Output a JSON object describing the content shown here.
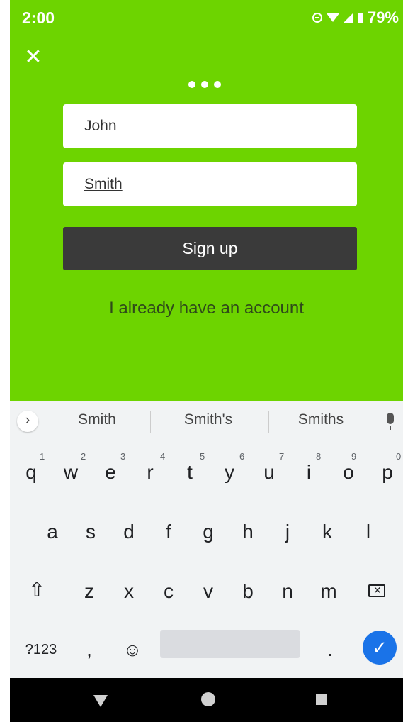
{
  "status_bar": {
    "time": "2:00",
    "battery": "79%"
  },
  "form": {
    "first_name_value": "John",
    "last_name_value": "Smith",
    "sign_up_label": "Sign up",
    "login_link": "I already have an account"
  },
  "keyboard": {
    "suggestions": [
      "Smith",
      "Smith's",
      "Smiths"
    ],
    "row1": [
      {
        "key": "q",
        "hint": "1"
      },
      {
        "key": "w",
        "hint": "2"
      },
      {
        "key": "e",
        "hint": "3"
      },
      {
        "key": "r",
        "hint": "4"
      },
      {
        "key": "t",
        "hint": "5"
      },
      {
        "key": "y",
        "hint": "6"
      },
      {
        "key": "u",
        "hint": "7"
      },
      {
        "key": "i",
        "hint": "8"
      },
      {
        "key": "o",
        "hint": "9"
      },
      {
        "key": "p",
        "hint": "0"
      }
    ],
    "row2": [
      "a",
      "s",
      "d",
      "f",
      "g",
      "h",
      "j",
      "k",
      "l"
    ],
    "row3": [
      "z",
      "x",
      "c",
      "v",
      "b",
      "n",
      "m"
    ],
    "symbols_label": "?123",
    "comma": ",",
    "period": ".",
    "icons": {
      "chevron": "chevron-right-icon",
      "mic": "mic-icon",
      "shift": "shift-icon",
      "delete": "backspace-icon",
      "emoji": "emoji-icon",
      "enter": "checkmark-icon"
    }
  },
  "colors": {
    "background": "#6dd400",
    "button_dark": "#3a3a3a",
    "enter_blue": "#1a73e8"
  }
}
